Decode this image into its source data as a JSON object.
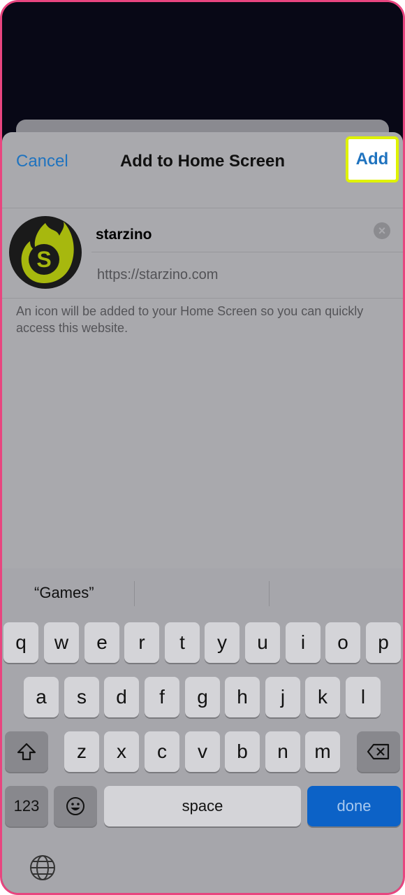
{
  "nav": {
    "cancel": "Cancel",
    "title": "Add to Home Screen",
    "add": "Add"
  },
  "app": {
    "icon_letter": "S",
    "name": "starzino",
    "url": "https://starzino.com"
  },
  "hint": "An icon will be added to your Home Screen so you can quickly access this website.",
  "keyboard": {
    "suggestions": [
      "“Games”",
      "",
      ""
    ],
    "row1": [
      "q",
      "w",
      "e",
      "r",
      "t",
      "y",
      "u",
      "i",
      "o",
      "p"
    ],
    "row2": [
      "a",
      "s",
      "d",
      "f",
      "g",
      "h",
      "j",
      "k",
      "l"
    ],
    "row3": [
      "z",
      "x",
      "c",
      "v",
      "b",
      "n",
      "m"
    ],
    "numbers": "123",
    "space": "space",
    "done": "done"
  },
  "colors": {
    "accent": "#1f73bf",
    "highlight": "#dff200",
    "frame": "#e8457f",
    "icon_flame": "#a7b80e"
  }
}
